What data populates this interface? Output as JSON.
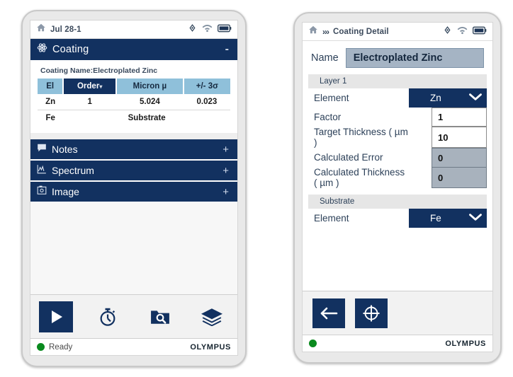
{
  "left": {
    "statusbar": {
      "home_icon": "home-icon",
      "title": "Jul 28-1",
      "icons": [
        "gps-icon",
        "wifi-icon",
        "battery-icon"
      ]
    },
    "section": {
      "icon": "atom-icon",
      "label": "Coating",
      "toggle": "-"
    },
    "coating_name": "Coating Name:Electroplated Zinc",
    "table": {
      "columns": [
        "El",
        "Order",
        "Micron µ",
        "+/- 3σ"
      ],
      "sorted_column": "Order",
      "rows": [
        [
          "Zn",
          "1",
          "5.024",
          "0.023"
        ],
        [
          "Fe",
          "Substrate",
          "",
          ""
        ]
      ]
    },
    "accordions": [
      {
        "icon": "notes-icon",
        "label": "Notes",
        "action": "+"
      },
      {
        "icon": "spectrum-icon",
        "label": "Spectrum",
        "action": "+"
      },
      {
        "icon": "image-icon",
        "label": "Image",
        "action": "+"
      }
    ],
    "toolbar": [
      {
        "icon": "play-icon",
        "name": "start-test-button"
      },
      {
        "icon": "timer-icon",
        "name": "timer-button"
      },
      {
        "icon": "folder-search-icon",
        "name": "browse-files-button"
      },
      {
        "icon": "layers-icon",
        "name": "layers-button"
      }
    ],
    "footer": {
      "status": "Ready",
      "status_color": "#0a8a1e",
      "brand": "OLYMPUS"
    }
  },
  "right": {
    "statusbar": {
      "home_icon": "home-icon",
      "breadcrumb_chevrons": "›››",
      "title": "Coating Detail",
      "icons": [
        "gps-icon",
        "wifi-icon",
        "battery-icon"
      ]
    },
    "name": {
      "label": "Name",
      "value": "Electroplated Zinc"
    },
    "layer_group": "Layer 1",
    "layer_fields": [
      {
        "label": "Element",
        "value": "Zn",
        "kind": "select"
      },
      {
        "label": "Factor",
        "value": "1",
        "kind": "input"
      },
      {
        "label": "Target Thickness ( µm )",
        "value": "10",
        "kind": "input"
      },
      {
        "label": "Calculated Error",
        "value": "0",
        "kind": "readonly"
      },
      {
        "label": "Calculated Thickness ( µm )",
        "value": "0",
        "kind": "readonly"
      }
    ],
    "substrate_group": "Substrate",
    "substrate_fields": [
      {
        "label": "Element",
        "value": "Fe",
        "kind": "select"
      }
    ],
    "toolbar": [
      {
        "icon": "back-arrow-icon",
        "name": "back-button"
      },
      {
        "icon": "target-icon",
        "name": "calibrate-button"
      }
    ],
    "footer": {
      "status": "",
      "status_color": "#0a8a1e",
      "brand": "OLYMPUS"
    }
  }
}
